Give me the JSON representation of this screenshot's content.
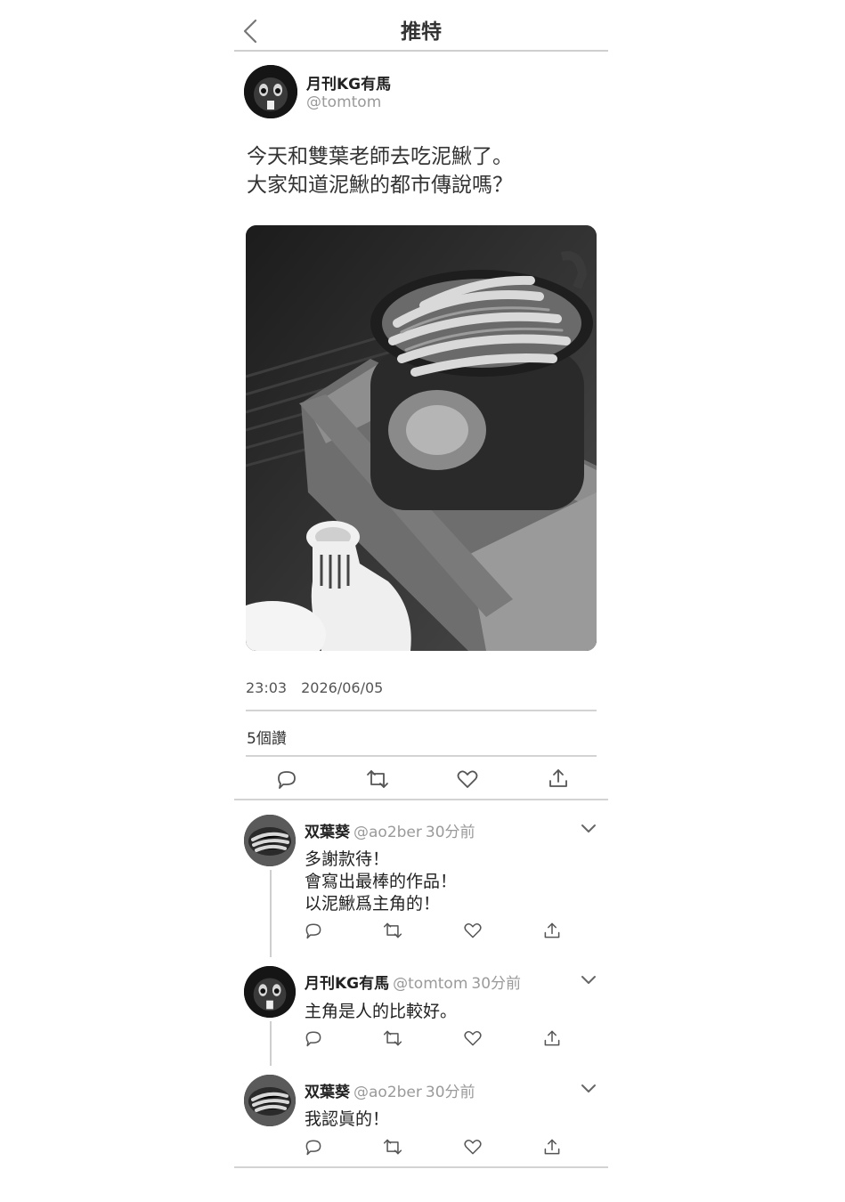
{
  "header": {
    "title": "推特"
  },
  "tweet": {
    "author": "月刊KG有馬",
    "handle": "@tomtom",
    "text": "今天和雙葉老師去吃泥鰍了。\n大家知道泥鰍的都市傳說嗎？",
    "time": "23:03",
    "date": "2026/06/05",
    "likes": "5個讚"
  },
  "replies": [
    {
      "author": "双葉葵",
      "handle": "@ao2ber",
      "time": "30分前",
      "text": "多謝款待！\n會寫出最棒的作品！\n以泥鰍爲主角的！"
    },
    {
      "author": "月刊KG有馬",
      "handle": "@tomtom",
      "time": "30分前",
      "text": "主角是人的比較好。"
    },
    {
      "author": "双葉葵",
      "handle": "@ao2ber",
      "time": "30分前",
      "text": "我認眞的！"
    }
  ],
  "icons": [
    "back-icon",
    "reply-icon",
    "retweet-icon",
    "like-icon",
    "share-icon",
    "chevron-down-icon"
  ]
}
